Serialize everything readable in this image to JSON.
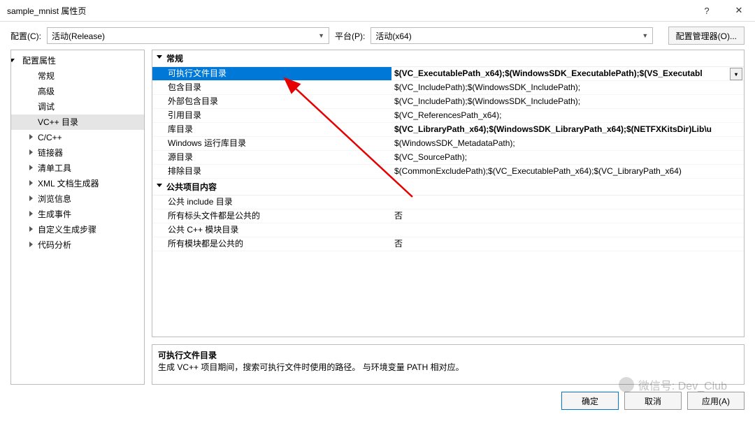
{
  "window": {
    "title": "sample_mnist 属性页",
    "help": "?",
    "close": "✕"
  },
  "toolbar": {
    "config_label": "配置(C):",
    "config_value": "活动(Release)",
    "platform_label": "平台(P):",
    "platform_value": "活动(x64)",
    "manager_btn": "配置管理器(O)..."
  },
  "tree": {
    "root": "配置属性",
    "items": [
      {
        "label": "常规",
        "expandable": false
      },
      {
        "label": "高级",
        "expandable": false
      },
      {
        "label": "调试",
        "expandable": false
      },
      {
        "label": "VC++ 目录",
        "expandable": false,
        "selected": true
      },
      {
        "label": "C/C++",
        "expandable": true
      },
      {
        "label": "链接器",
        "expandable": true
      },
      {
        "label": "清单工具",
        "expandable": true
      },
      {
        "label": "XML 文档生成器",
        "expandable": true
      },
      {
        "label": "浏览信息",
        "expandable": true
      },
      {
        "label": "生成事件",
        "expandable": true
      },
      {
        "label": "自定义生成步骤",
        "expandable": true
      },
      {
        "label": "代码分析",
        "expandable": true
      }
    ]
  },
  "grid": {
    "groups": [
      {
        "name": "常规",
        "rows": [
          {
            "k": "可执行文件目录",
            "v": "$(VC_ExecutablePath_x64);$(WindowsSDK_ExecutablePath);$(VS_Executabl",
            "bold": true,
            "selected": true
          },
          {
            "k": "包含目录",
            "v": "$(VC_IncludePath);$(WindowsSDK_IncludePath);"
          },
          {
            "k": "外部包含目录",
            "v": "$(VC_IncludePath);$(WindowsSDK_IncludePath);"
          },
          {
            "k": "引用目录",
            "v": "$(VC_ReferencesPath_x64);"
          },
          {
            "k": "库目录",
            "v": "$(VC_LibraryPath_x64);$(WindowsSDK_LibraryPath_x64);$(NETFXKitsDir)Lib\\u",
            "bold": true
          },
          {
            "k": "Windows 运行库目录",
            "v": "$(WindowsSDK_MetadataPath);"
          },
          {
            "k": "源目录",
            "v": "$(VC_SourcePath);"
          },
          {
            "k": "排除目录",
            "v": "$(CommonExcludePath);$(VC_ExecutablePath_x64);$(VC_LibraryPath_x64)"
          }
        ]
      },
      {
        "name": "公共项目内容",
        "rows": [
          {
            "k": "公共 include 目录",
            "v": ""
          },
          {
            "k": "所有标头文件都是公共的",
            "v": "否"
          },
          {
            "k": "公共 C++ 模块目录",
            "v": ""
          },
          {
            "k": "所有模块都是公共的",
            "v": "否"
          }
        ]
      }
    ]
  },
  "desc": {
    "title": "可执行文件目录",
    "text": "生成 VC++ 项目期间，搜索可执行文件时使用的路径。   与环境变量 PATH 相对应。"
  },
  "footer": {
    "ok": "确定",
    "cancel": "取消",
    "apply": "应用(A)"
  },
  "watermark": "微信号: Dev_Club"
}
